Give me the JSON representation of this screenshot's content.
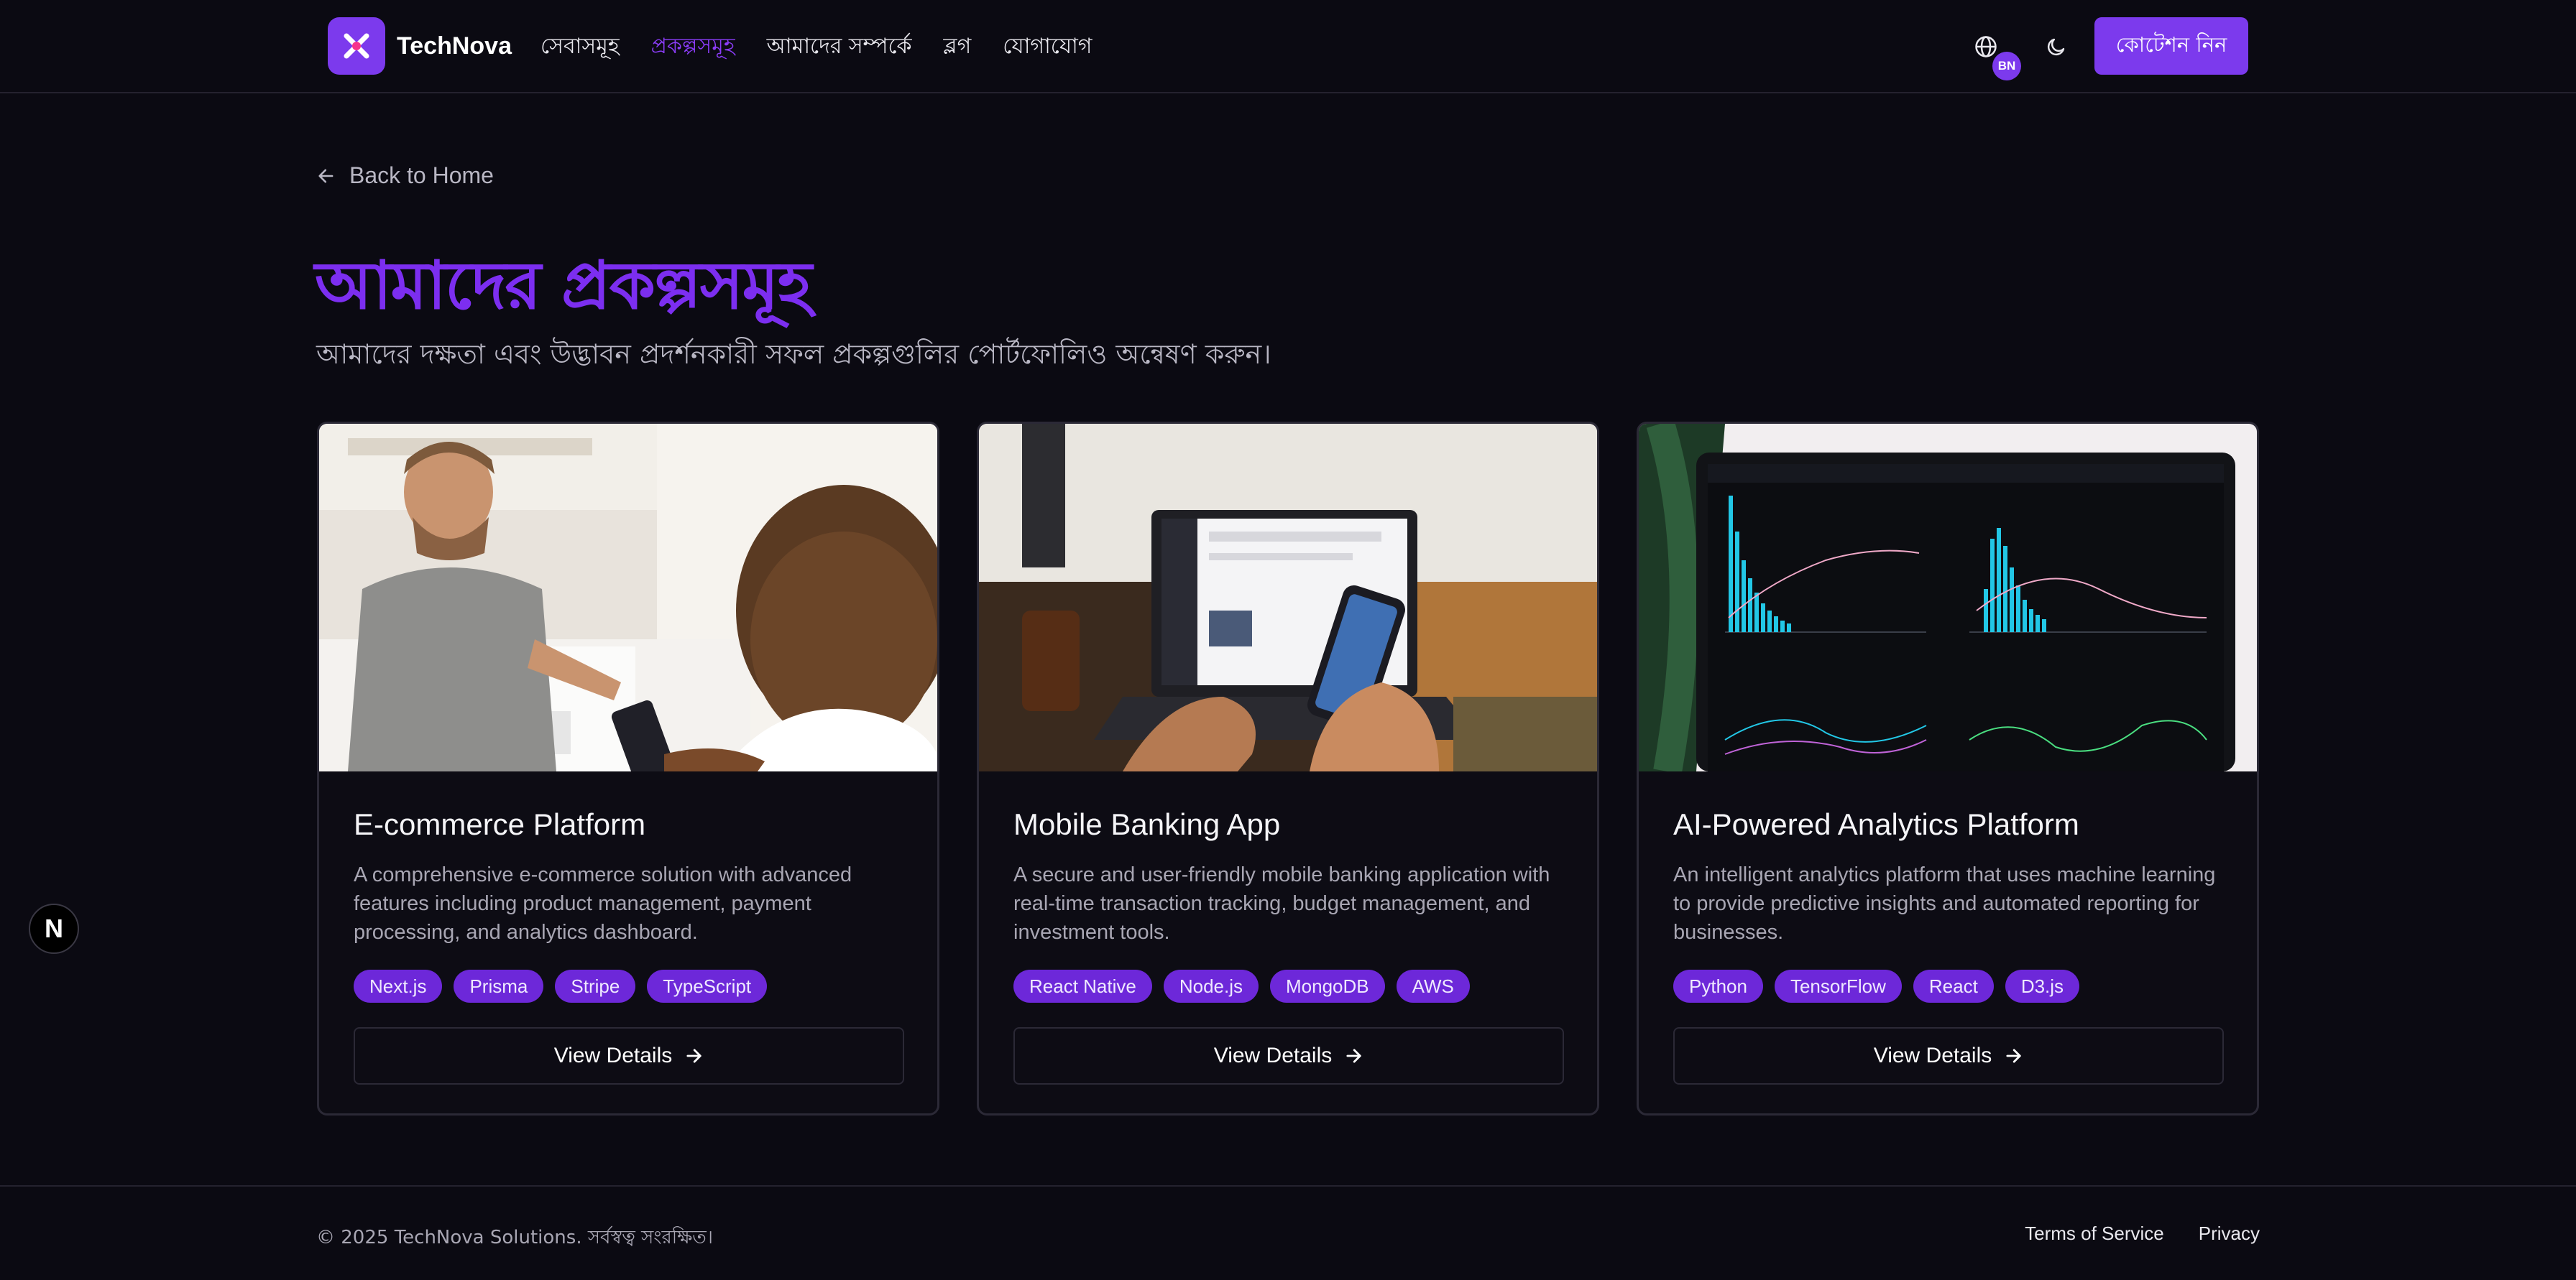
{
  "brand": {
    "name": "TechNova",
    "accent": "#7c3aed"
  },
  "nav": {
    "items": [
      {
        "label": "সেবাসমূহ",
        "active": false
      },
      {
        "label": "প্রকল্পসমূহ",
        "active": true
      },
      {
        "label": "আমাদের সম্পর্কে",
        "active": false
      },
      {
        "label": "ব্লগ",
        "active": false
      },
      {
        "label": "যোগাযোগ",
        "active": false
      }
    ]
  },
  "header": {
    "language_badge": "BN",
    "language_icon": "globe-icon",
    "theme_icon": "moon-icon",
    "quote_button": "কোটেশন নিন"
  },
  "main": {
    "back_link": "Back to Home",
    "title": "আমাদের প্রকল্পসমূহ",
    "subtitle": "আমাদের দক্ষতা এবং উদ্ভাবন প্রদর্শনকারী সফল প্রকল্পগুলির পোর্টফোলিও অন্বেষণ করুন।",
    "projects": [
      {
        "title": "E-commerce Platform",
        "description": "A comprehensive e-commerce solution with advanced features including product management, payment processing, and analytics dashboard.",
        "tags": [
          "Next.js",
          "Prisma",
          "Stripe",
          "TypeScript"
        ],
        "button": "View Details"
      },
      {
        "title": "Mobile Banking App",
        "description": "A secure and user-friendly mobile banking application with real-time transaction tracking, budget management, and investment tools.",
        "tags": [
          "React Native",
          "Node.js",
          "MongoDB",
          "AWS"
        ],
        "button": "View Details"
      },
      {
        "title": "AI-Powered Analytics Platform",
        "description": "An intelligent analytics platform that uses machine learning to provide predictive insights and automated reporting for businesses.",
        "tags": [
          "Python",
          "TensorFlow",
          "React",
          "D3.js"
        ],
        "button": "View Details"
      }
    ]
  },
  "dev_badge": "N",
  "footer": {
    "copyright": "© 2025 TechNova Solutions. সর্বস্বত্ব সংরক্ষিত।",
    "links": [
      "Terms of Service",
      "Privacy"
    ]
  }
}
